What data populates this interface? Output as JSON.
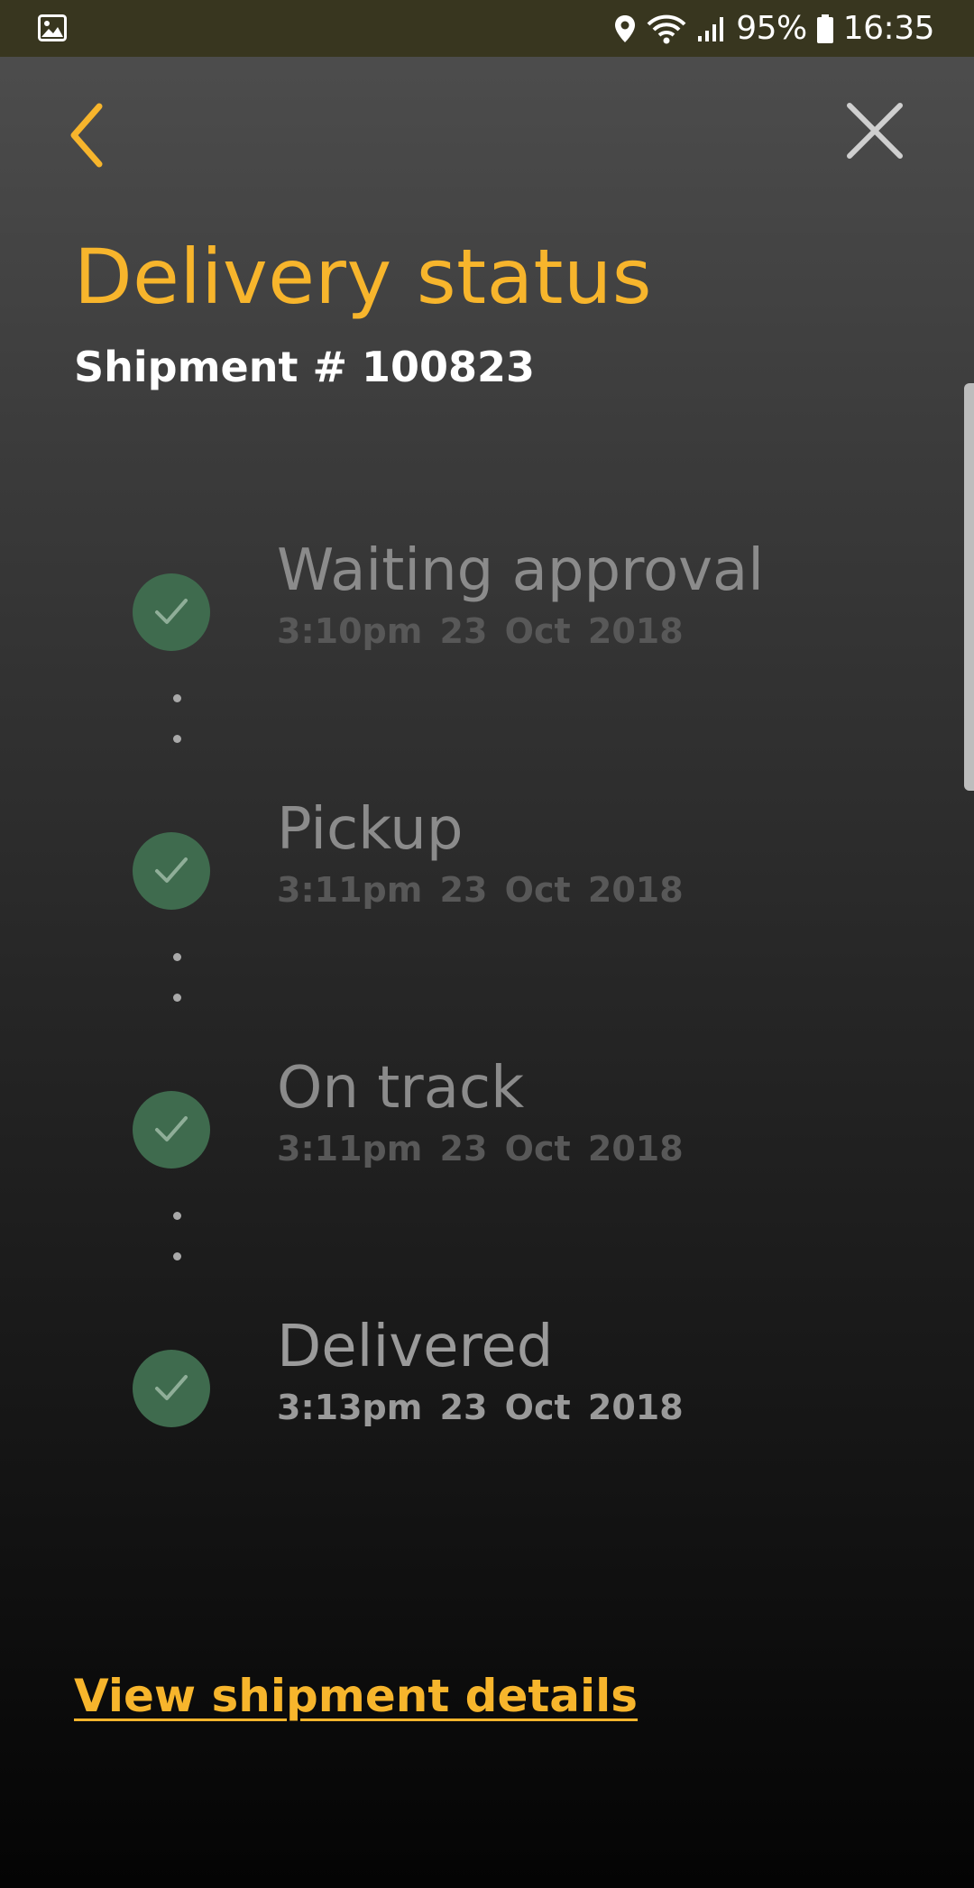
{
  "status_bar": {
    "battery_percent": "95%",
    "time": "16:35"
  },
  "header": {
    "title": "Delivery status",
    "subtitle": "Shipment # 100823"
  },
  "timeline": [
    {
      "label": "Waiting approval",
      "time": "3:10pm  23 Oct 2018"
    },
    {
      "label": "Pickup",
      "time": "3:11pm  23 Oct 2018"
    },
    {
      "label": "On track",
      "time": "3:11pm  23 Oct 2018"
    },
    {
      "label": "Delivered",
      "time": "3:13pm  23 Oct 2018"
    }
  ],
  "footer": {
    "details_link": "View shipment details"
  },
  "colors": {
    "accent": "#f7b52c",
    "check_circle": "#3f6b4e",
    "status_bar": "#38361f"
  }
}
